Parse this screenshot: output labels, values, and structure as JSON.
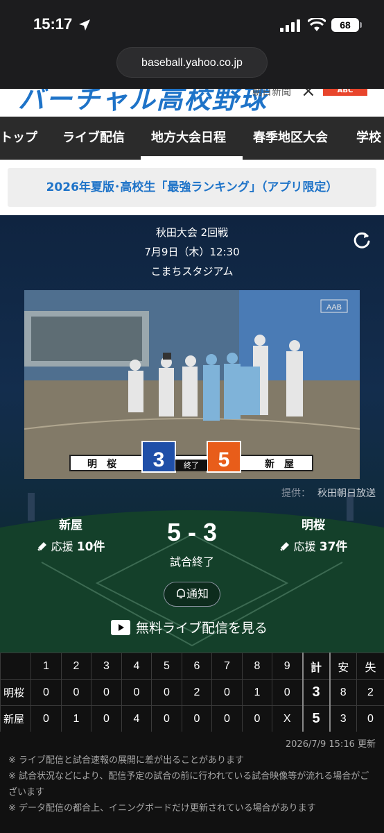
{
  "status_bar": {
    "time": "15:17",
    "battery": "68"
  },
  "browser": {
    "url": "baseball.yahoo.co.jp"
  },
  "banner": {
    "logo_text": "バーチャル高校野球",
    "partner_text": "朝日新聞",
    "abc_text": "ABC"
  },
  "tabs": [
    {
      "label": "トップ"
    },
    {
      "label": "ライブ配信"
    },
    {
      "label": "地方大会日程",
      "active": true
    },
    {
      "label": "春季地区大会"
    },
    {
      "label": "学校"
    }
  ],
  "promo": {
    "text": "2026年夏版･高校生「最強ランキング」（アプリ限定）"
  },
  "game": {
    "tournament": "秋田大会 2回戦",
    "datetime": "7月9日（木）12:30",
    "venue": "こまちスタジアム",
    "video_overlay": {
      "team_left": "明　桜",
      "score_left": "3",
      "state": "終了",
      "score_right": "5",
      "team_right": "新　屋",
      "channel": "AAB"
    },
    "credit_label": "提供：",
    "credit_value": "秋田朝日放送",
    "home_team": {
      "name": "新屋",
      "cheer_label": "応援",
      "cheer_count": "10件"
    },
    "away_team": {
      "name": "明桜",
      "cheer_label": "応援",
      "cheer_count": "37件"
    },
    "score": "5 - 3",
    "status": "試合終了",
    "notify_label": "通知",
    "live_link": "無料ライブ配信を見る"
  },
  "scoreboard": {
    "headers": [
      "",
      "1",
      "2",
      "3",
      "4",
      "5",
      "6",
      "7",
      "8",
      "9",
      "計",
      "安",
      "失"
    ],
    "rows": [
      {
        "team": "明桜",
        "innings": [
          "0",
          "0",
          "0",
          "0",
          "0",
          "2",
          "0",
          "1",
          "0"
        ],
        "total": "3",
        "hits": "8",
        "errors": "2"
      },
      {
        "team": "新屋",
        "innings": [
          "0",
          "1",
          "0",
          "4",
          "0",
          "0",
          "0",
          "0",
          "X"
        ],
        "total": "5",
        "hits": "3",
        "errors": "0"
      }
    ]
  },
  "footer": {
    "updated": "2026/7/9 15:16 更新",
    "notes": [
      "※ ライブ配信と試合速報の展開に差が出ることがあります",
      "※ 試合状況などにより、配信予定の試合の前に行われている試合映像等が流れる場合がございます",
      "※ データ配信の都合上、イニングボードだけ更新されている場合があります"
    ]
  },
  "colors": {
    "accent_blue": "#1e73c8",
    "score_blue": "#1f4fa8",
    "score_orange": "#e85d1a"
  }
}
